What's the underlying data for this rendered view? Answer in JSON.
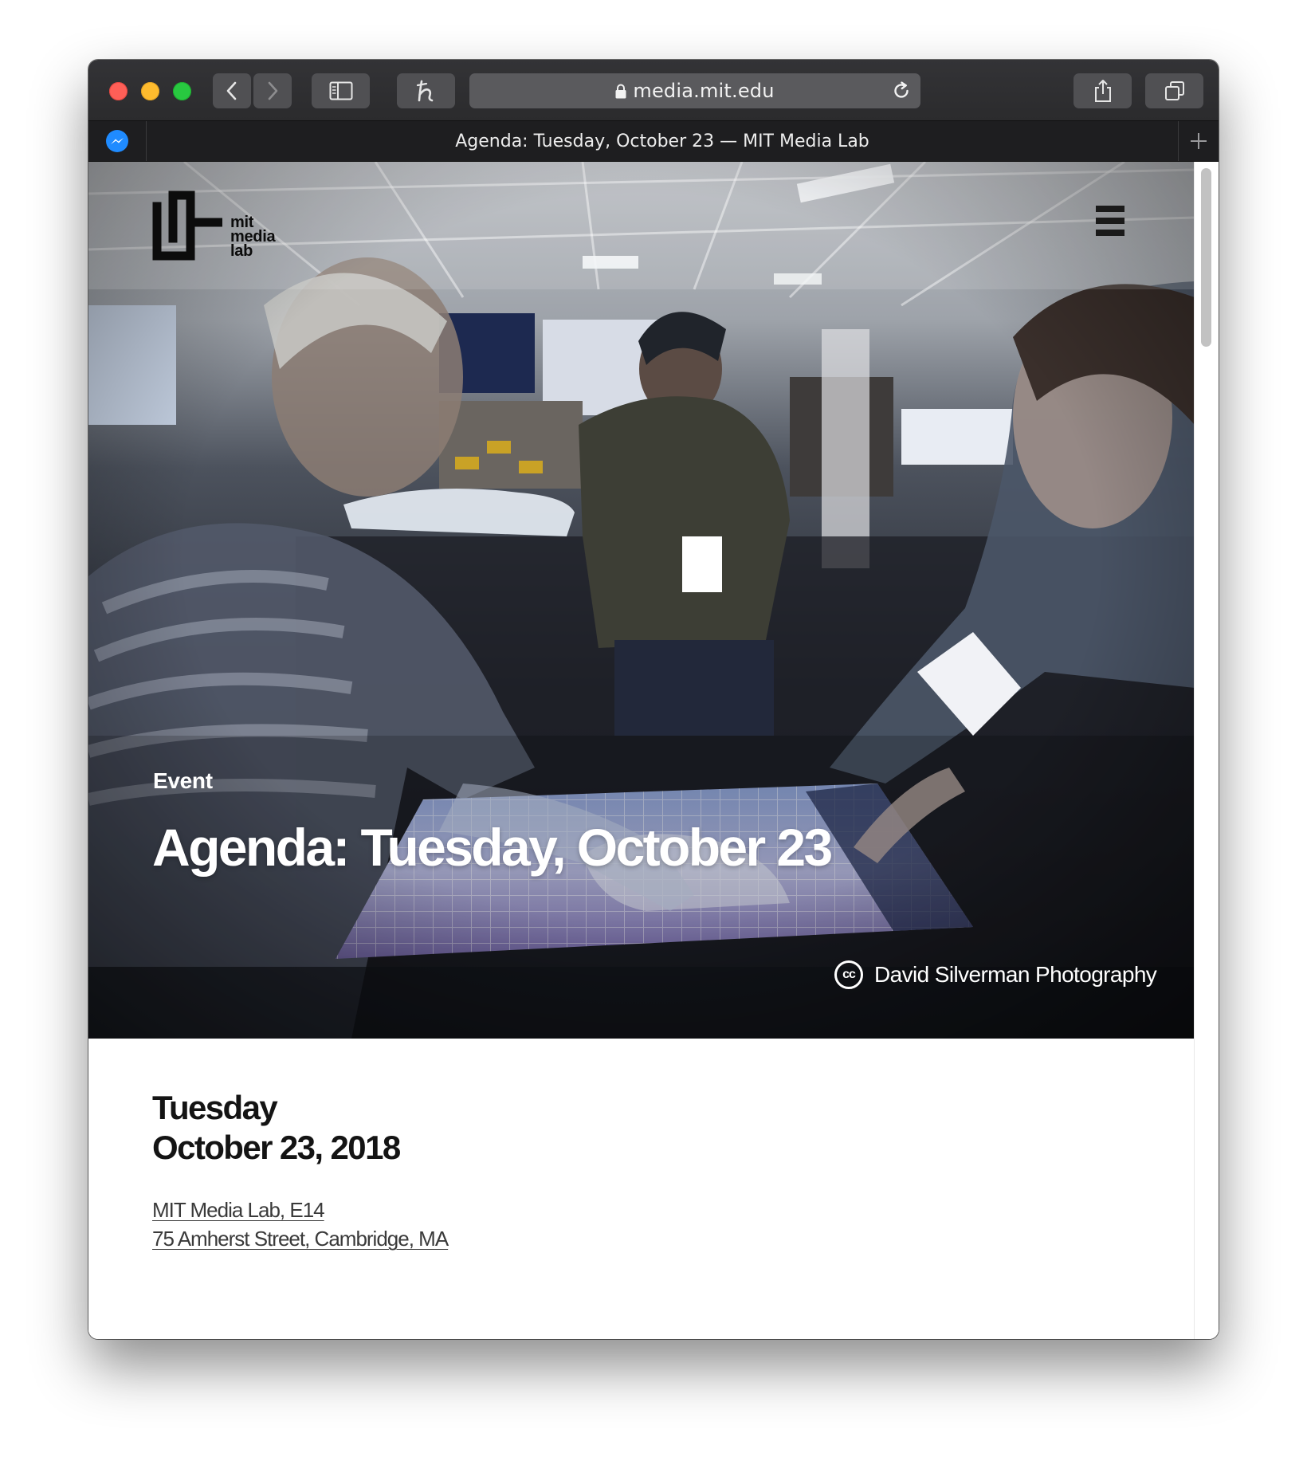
{
  "browser": {
    "address": "media.mit.edu",
    "tab_title": "Agenda: Tuesday, October 23 — MIT Media Lab"
  },
  "logo": {
    "line1": "mit",
    "line2": "media",
    "line3": "lab"
  },
  "hero": {
    "eyebrow": "Event",
    "title": "Agenda: Tuesday, October 23",
    "credit_badge": "cc",
    "credit": "David Silverman Photography"
  },
  "event": {
    "weekday": "Tuesday",
    "date": "October 23, 2018",
    "venue_line1": "MIT Media Lab, E14",
    "venue_line2": "75 Amherst Street, Cambridge, MA"
  },
  "colors": {
    "toolbar": "#2f2f31",
    "tabbar": "#1e1e20",
    "text_dark": "#141414",
    "link": "#3a3a3a"
  }
}
